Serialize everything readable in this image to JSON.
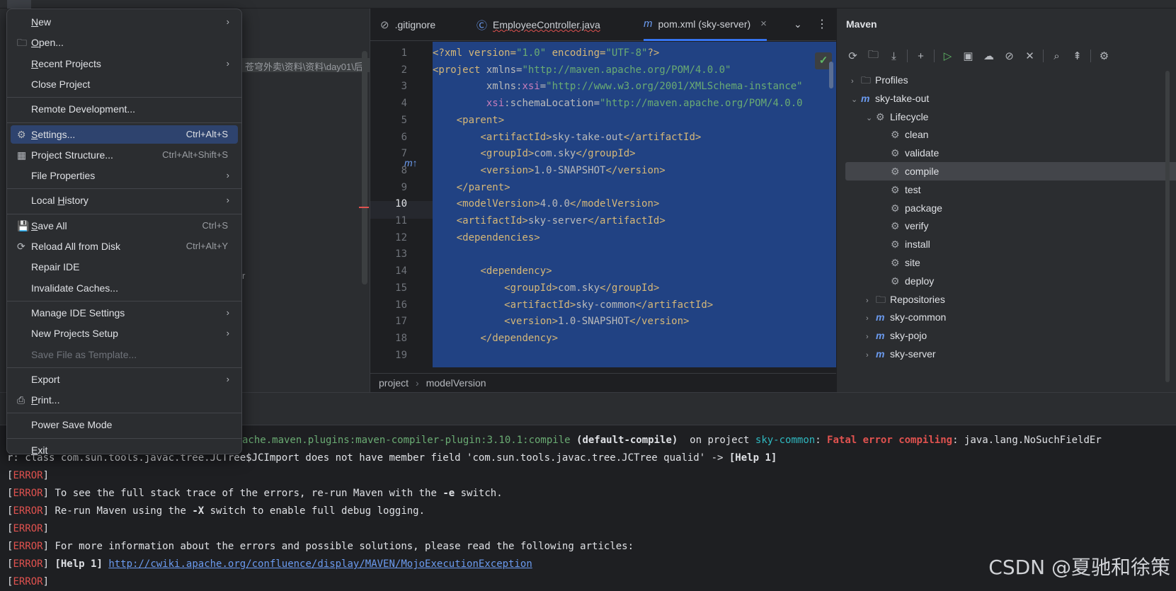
{
  "project_panel": {
    "path_fragment": "苍穹外卖\\资料\\资料\\day01\\后",
    "text_fragment": "r"
  },
  "editor": {
    "tabs": [
      {
        "label": ".gitignore",
        "icon": "no-entry-icon"
      },
      {
        "label": "EmployeeController.java",
        "icon": "class-c-icon"
      },
      {
        "label": "pom.xml (sky-server)",
        "icon": "maven-m-icon",
        "close": "×"
      }
    ],
    "more_tabs": "⌄",
    "kebab": "⋮",
    "line_numbers": [
      "1",
      "2",
      "3",
      "4",
      "5",
      "6",
      "7",
      "8",
      "9",
      "10",
      "11",
      "12",
      "13",
      "14",
      "15",
      "16",
      "17",
      "18",
      "19"
    ],
    "current_line": "10",
    "breadcrumb": [
      "project",
      "modelVersion"
    ]
  },
  "code_lines": [
    {
      "indent": "",
      "parts": [
        [
          "tg",
          "<?xml version="
        ],
        [
          "av",
          "\"1.0\""
        ],
        [
          "tg",
          " encoding="
        ],
        [
          "av",
          "\"UTF-8\""
        ],
        [
          "tg",
          "?>"
        ]
      ]
    },
    {
      "indent": "",
      "parts": [
        [
          "tg",
          "<project "
        ],
        [
          "at",
          "xmlns="
        ],
        [
          "av",
          "\"http://maven.apache.org/POM/4.0.0\""
        ]
      ]
    },
    {
      "indent": "         ",
      "parts": [
        [
          "at",
          "xmlns:"
        ],
        [
          "ns",
          "xsi"
        ],
        [
          "at",
          "="
        ],
        [
          "av",
          "\"http://www.w3.org/2001/XMLSchema-instance\""
        ]
      ]
    },
    {
      "indent": "         ",
      "parts": [
        [
          "ns",
          "xsi"
        ],
        [
          "at",
          ":schemaLocation="
        ],
        [
          "av",
          "\"http://maven.apache.org/POM/4.0.0"
        ]
      ]
    },
    {
      "indent": "    ",
      "parts": [
        [
          "tg",
          "<parent>"
        ]
      ]
    },
    {
      "indent": "        ",
      "parts": [
        [
          "tg",
          "<artifactId>"
        ],
        [
          "at",
          "sky-take-out"
        ],
        [
          "tg",
          "</artifactId>"
        ]
      ]
    },
    {
      "indent": "        ",
      "parts": [
        [
          "tg",
          "<groupId>"
        ],
        [
          "at",
          "com.sky"
        ],
        [
          "tg",
          "</groupId>"
        ]
      ]
    },
    {
      "indent": "        ",
      "parts": [
        [
          "tg",
          "<version>"
        ],
        [
          "at",
          "1.0-SNAPSHOT"
        ],
        [
          "tg",
          "</version>"
        ]
      ]
    },
    {
      "indent": "    ",
      "parts": [
        [
          "tg",
          "</parent>"
        ]
      ]
    },
    {
      "indent": "    ",
      "parts": [
        [
          "tg",
          "<modelVersion>"
        ],
        [
          "at",
          "4.0.0"
        ],
        [
          "tg",
          "</modelVersion>"
        ]
      ]
    },
    {
      "indent": "    ",
      "parts": [
        [
          "tg",
          "<artifactId>"
        ],
        [
          "at",
          "sky-server"
        ],
        [
          "tg",
          "</artifactId>"
        ]
      ]
    },
    {
      "indent": "    ",
      "parts": [
        [
          "tg",
          "<dependencies>"
        ]
      ]
    },
    {
      "indent": "",
      "parts": []
    },
    {
      "indent": "        ",
      "parts": [
        [
          "tg",
          "<dependency>"
        ]
      ]
    },
    {
      "indent": "            ",
      "parts": [
        [
          "tg",
          "<groupId>"
        ],
        [
          "at",
          "com.sky"
        ],
        [
          "tg",
          "</groupId>"
        ]
      ]
    },
    {
      "indent": "            ",
      "parts": [
        [
          "tg",
          "<artifactId>"
        ],
        [
          "at",
          "sky-common"
        ],
        [
          "tg",
          "</artifactId>"
        ]
      ]
    },
    {
      "indent": "            ",
      "parts": [
        [
          "tg",
          "<version>"
        ],
        [
          "at",
          "1.0-SNAPSHOT"
        ],
        [
          "tg",
          "</version>"
        ]
      ]
    },
    {
      "indent": "        ",
      "parts": [
        [
          "tg",
          "</dependency>"
        ]
      ]
    },
    {
      "indent": "",
      "parts": []
    }
  ],
  "maven": {
    "title": "Maven",
    "toolbar": [
      "reload-icon",
      "add-folder-icon",
      "download-icon",
      "|",
      "plus-icon",
      "|",
      "run-icon",
      "run-config-icon",
      "offline-icon",
      "skip-tests-icon",
      "collapse-icon",
      "|",
      "analyze-icon",
      "expand-icon",
      "|",
      "settings-icon"
    ],
    "tree": [
      {
        "label": "Profiles",
        "level": 0,
        "chev": "›",
        "icon": "folder"
      },
      {
        "label": "sky-take-out",
        "level": 0,
        "chev": "⌄",
        "icon": "m"
      },
      {
        "label": "Lifecycle",
        "level": 1,
        "chev": "⌄",
        "icon": "folder-gear"
      },
      {
        "label": "clean",
        "level": 2,
        "chev": "",
        "icon": "gear"
      },
      {
        "label": "validate",
        "level": 2,
        "chev": "",
        "icon": "gear"
      },
      {
        "label": "compile",
        "level": 2,
        "chev": "",
        "icon": "gear",
        "selected": true
      },
      {
        "label": "test",
        "level": 2,
        "chev": "",
        "icon": "gear"
      },
      {
        "label": "package",
        "level": 2,
        "chev": "",
        "icon": "gear"
      },
      {
        "label": "verify",
        "level": 2,
        "chev": "",
        "icon": "gear"
      },
      {
        "label": "install",
        "level": 2,
        "chev": "",
        "icon": "gear"
      },
      {
        "label": "site",
        "level": 2,
        "chev": "",
        "icon": "gear"
      },
      {
        "label": "deploy",
        "level": 2,
        "chev": "",
        "icon": "gear"
      },
      {
        "label": "Repositories",
        "level": 1,
        "chev": "›",
        "icon": "folder"
      },
      {
        "label": "sky-common",
        "level": 1,
        "chev": "›",
        "icon": "m"
      },
      {
        "label": "sky-pojo",
        "level": 1,
        "chev": "›",
        "icon": "m"
      },
      {
        "label": "sky-server",
        "level": 1,
        "chev": "›",
        "icon": "m"
      }
    ]
  },
  "output_lines": [
    [
      [
        "gr",
        "ache.maven.plugins:maven-compiler-plugin:3.10.1:compile "
      ],
      [
        "b",
        "(default-compile)"
      ],
      [
        "",
        "  on project "
      ],
      [
        "cyan",
        "sky-common"
      ],
      [
        "",
        ": "
      ],
      [
        "err b",
        "Fatal error compiling"
      ],
      [
        "",
        ": java.lang.NoSuchFieldEr"
      ]
    ],
    [
      [
        "",
        "r: class com.sun.tools.javac.tree.JCTree$JCImport does not have member field 'com.sun.tools.javac.tree.JCTree qualid' -> "
      ],
      [
        "b",
        "[Help 1]"
      ]
    ],
    [
      [
        "",
        "["
      ],
      [
        "err",
        "ERROR"
      ],
      [
        "",
        "]"
      ]
    ],
    [
      [
        "",
        "["
      ],
      [
        "err",
        "ERROR"
      ],
      [
        "",
        "] To see the full stack trace of the errors, re-run Maven with the "
      ],
      [
        "b",
        "-e"
      ],
      [
        "",
        " switch."
      ]
    ],
    [
      [
        "",
        "["
      ],
      [
        "err",
        "ERROR"
      ],
      [
        "",
        "] Re-run Maven using the "
      ],
      [
        "b",
        "-X"
      ],
      [
        "",
        " switch to enable full debug logging."
      ]
    ],
    [
      [
        "",
        "["
      ],
      [
        "err",
        "ERROR"
      ],
      [
        "",
        "]"
      ]
    ],
    [
      [
        "",
        "["
      ],
      [
        "err",
        "ERROR"
      ],
      [
        "",
        "] For more information about the errors and possible solutions, please read the following articles:"
      ]
    ],
    [
      [
        "",
        "["
      ],
      [
        "err",
        "ERROR"
      ],
      [
        "",
        "] "
      ],
      [
        "b",
        "[Help 1]"
      ],
      [
        "",
        " "
      ],
      [
        "lnk",
        "http://cwiki.apache.org/confluence/display/MAVEN/MojoExecutionException"
      ]
    ],
    [
      [
        "",
        "["
      ],
      [
        "err",
        "ERROR"
      ],
      [
        "",
        "]"
      ]
    ]
  ],
  "watermark": "CSDN @夏驰和徐策",
  "menu": {
    "items": [
      {
        "label": "New",
        "u": "N",
        "rest": "ew",
        "arrow": "›",
        "icon": ""
      },
      {
        "label": "Open...",
        "u": "O",
        "rest": "pen...",
        "icon": "folder-icon"
      },
      {
        "label": "Recent Projects",
        "u": "R",
        "rest": "ecent Projects",
        "arrow": "›"
      },
      {
        "label": "Close Project"
      },
      {
        "sep": true
      },
      {
        "label": "Remote Development..."
      },
      {
        "sep": true
      },
      {
        "label": "Settings...",
        "u": "S",
        "rest": "ettings...",
        "shortcut": "Ctrl+Alt+S",
        "icon": "gear-icon",
        "hi": true
      },
      {
        "label": "Project Structure...",
        "shortcut": "Ctrl+Alt+Shift+S",
        "icon": "structure-icon"
      },
      {
        "label": "File Properties",
        "arrow": "›"
      },
      {
        "sep": true
      },
      {
        "label": "Local History",
        "pre": "Local ",
        "u": "H",
        "rest": "istory",
        "arrow": "›"
      },
      {
        "sep": true
      },
      {
        "label": "Save All",
        "u": "S",
        "rest": "ave All",
        "shortcut": "Ctrl+S",
        "icon": "save-icon"
      },
      {
        "label": "Reload All from Disk",
        "shortcut": "Ctrl+Alt+Y",
        "icon": "reload-icon"
      },
      {
        "label": "Repair IDE"
      },
      {
        "label": "Invalidate Caches..."
      },
      {
        "sep": true
      },
      {
        "label": "Manage IDE Settings",
        "arrow": "›"
      },
      {
        "label": "New Projects Setup",
        "arrow": "›"
      },
      {
        "label": "Save File as Template...",
        "disabled": true
      },
      {
        "sep": true
      },
      {
        "label": "Export",
        "arrow": "›"
      },
      {
        "label": "Print...",
        "u": "P",
        "rest": "rint...",
        "icon": "print-icon"
      },
      {
        "sep": true
      },
      {
        "label": "Power Save Mode"
      },
      {
        "sep": true
      },
      {
        "label": "Exit",
        "u": "E",
        "rest": "xit"
      }
    ]
  },
  "colors": {
    "accent": "#3574f0",
    "selection": "#214283",
    "error": "#e0524f",
    "menu_highlight": "#2e436e"
  }
}
